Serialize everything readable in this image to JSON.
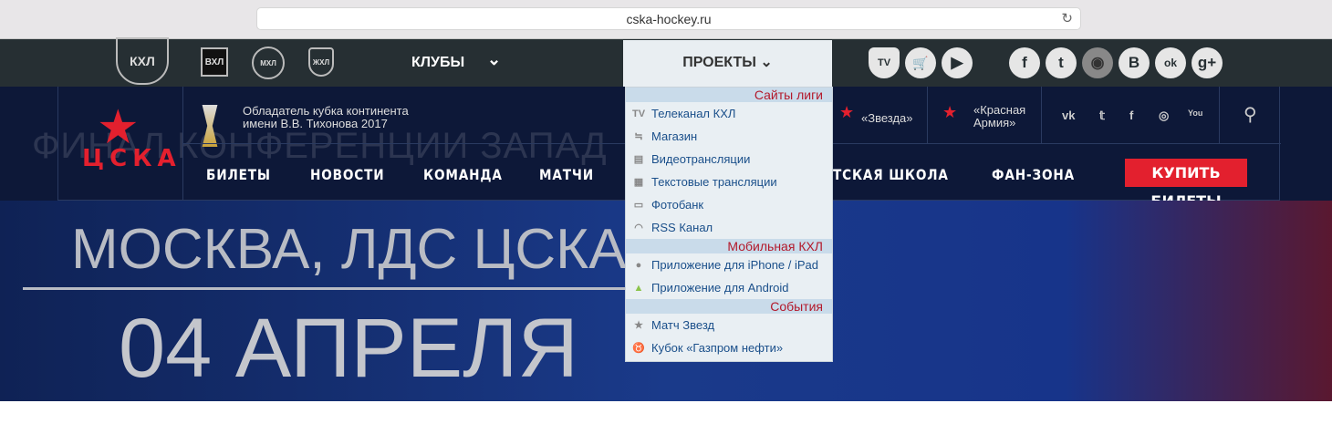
{
  "browser": {
    "url": "cska-hockey.ru"
  },
  "topnav": {
    "leagues": [
      "КХЛ",
      "ВХЛ",
      "МХЛ",
      "ЖХЛ"
    ],
    "clubs_label": "КЛУБЫ",
    "projects_label": "ПРОЕКТЫ",
    "service_icons": [
      "TV",
      "🛒",
      "▶"
    ],
    "social": [
      "f",
      "t",
      "◉",
      "B",
      "ok",
      "g+"
    ]
  },
  "header": {
    "logo": "ЦСКА",
    "cup_line1": "Обладатель кубка континента",
    "cup_line2": "имени В.В. Тихонова 2017",
    "faded_text": "ФИНАЛ КОНФЕРЕНЦИИ ЗАПАД",
    "zvezda": "«Звезда»",
    "krasnaya": "«Красная",
    "armiya": "Армия»",
    "social": [
      "vk",
      "𝕥",
      "f",
      "◎",
      "You"
    ],
    "nav": [
      "БИЛЕТЫ",
      "НОВОСТИ",
      "КОМАНДА",
      "МАТЧИ",
      "ТСКАЯ ШКОЛА",
      "ФАН-ЗОНА"
    ],
    "buy": "КУПИТЬ БИЛЕТЫ"
  },
  "hero": {
    "place": "МОСКВА, ЛДС ЦСКА",
    "date": "04 АПРЕЛЯ"
  },
  "dropdown": {
    "sections": [
      {
        "title": "Сайты лиги",
        "items": [
          {
            "icon": "TV",
            "label": "Телеканал КХЛ"
          },
          {
            "icon": "≒",
            "label": "Магазин"
          },
          {
            "icon": "▤",
            "label": "Видеотрансляции"
          },
          {
            "icon": "▦",
            "label": "Текстовые трансляции"
          },
          {
            "icon": "▭",
            "label": "Фотобанк"
          },
          {
            "icon": "◠",
            "label": "RSS Канал"
          }
        ]
      },
      {
        "title": "Мобильная КХЛ",
        "items": [
          {
            "icon": "●",
            "label": "Приложение для iPhone / iPad"
          },
          {
            "icon": "▲",
            "label": "Приложение для Android"
          }
        ]
      },
      {
        "title": "События",
        "items": [
          {
            "icon": "★",
            "label": "Матч Звезд"
          },
          {
            "icon": "♉",
            "label": "Кубок «Газпром нефти»"
          }
        ]
      }
    ]
  }
}
